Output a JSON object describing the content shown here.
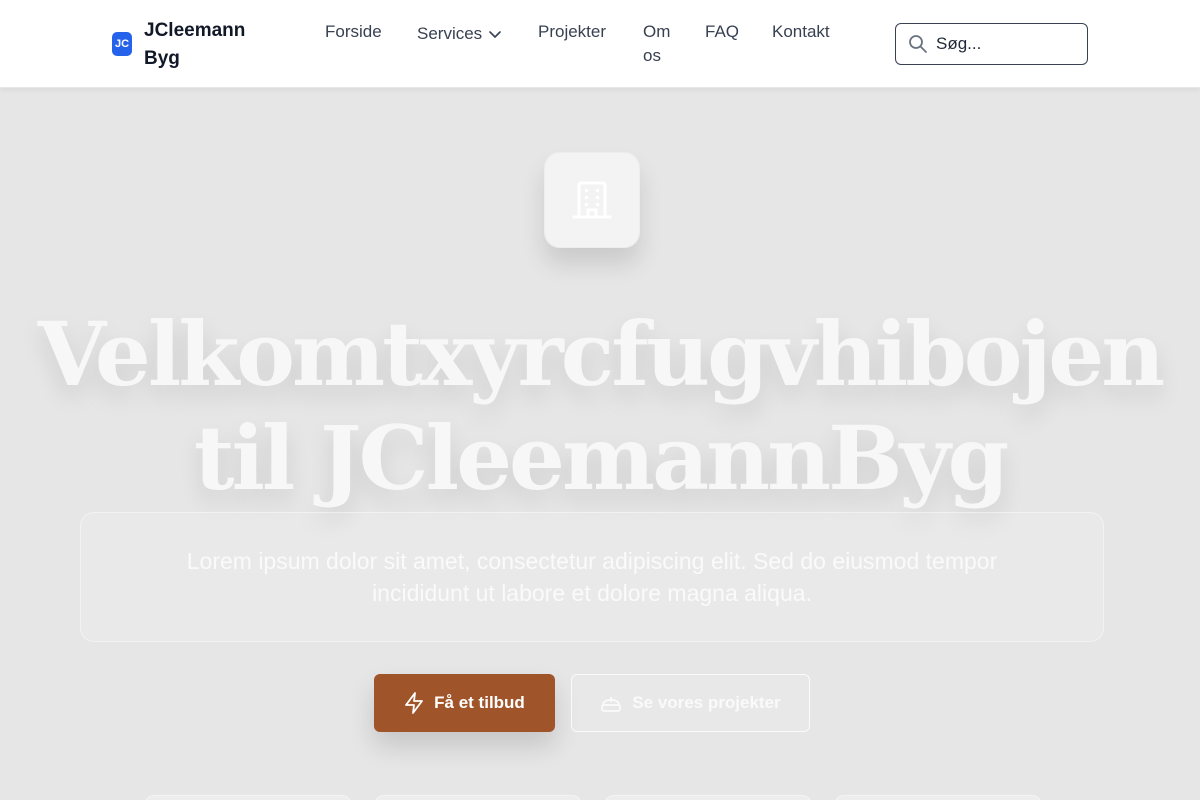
{
  "brand": {
    "badge": "JC",
    "name": "JCleemann Byg",
    "accent": "#2563eb"
  },
  "nav": {
    "items": [
      {
        "label": "Forside"
      },
      {
        "label": "Services"
      },
      {
        "label": "Projekter"
      },
      {
        "label": "Om os"
      },
      {
        "label": "FAQ"
      },
      {
        "label": "Kontakt"
      }
    ]
  },
  "search": {
    "placeholder": "Søg...",
    "icon": "search-icon"
  },
  "hero": {
    "icon": "building-icon",
    "title": "Velkomtxyrcfugvhibojen til JCleemannByg",
    "description": "Lorem ipsum dolor sit amet, consectetur adipiscing elit. Sed do eiusmod tempor incididunt ut labore et dolore magna aliqua.",
    "primary_button": {
      "label": "Få et tilbud",
      "icon": "lightning-icon",
      "color": "#a0542a"
    },
    "secondary_button": {
      "label": "Se vores projekter",
      "icon": "helmet-icon"
    }
  }
}
